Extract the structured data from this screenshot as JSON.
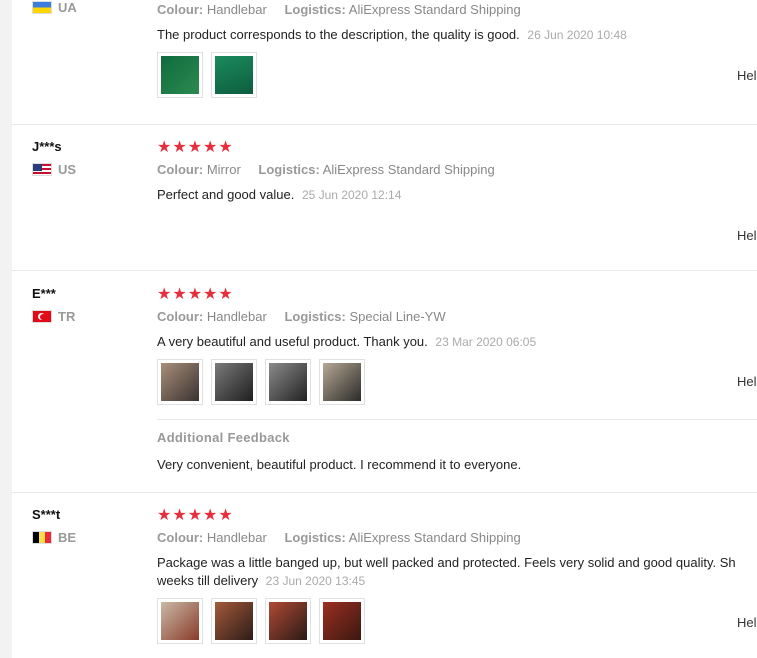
{
  "reviews": [
    {
      "name": "",
      "country": "UA",
      "colour_label": "Colour:",
      "colour": "Handlebar",
      "logistics_label": "Logistics:",
      "logistics": "AliExpress Standard Shipping",
      "text": "The product corresponds to the description, the quality is good.",
      "date": "26 Jun 2020 10:48",
      "helpful": "Hel",
      "thumbs": [
        "#1f6b3a",
        "#1f7a5a"
      ]
    },
    {
      "name": "J***s",
      "country": "US",
      "stars": "★★★★★",
      "colour_label": "Colour:",
      "colour": "Mirror",
      "logistics_label": "Logistics:",
      "logistics": "AliExpress Standard Shipping",
      "text": "Perfect and good value.",
      "date": "25 Jun 2020 12:14",
      "helpful": "Hel"
    },
    {
      "name": "E***",
      "country": "TR",
      "stars": "★★★★★",
      "colour_label": "Colour:",
      "colour": "Handlebar",
      "logistics_label": "Logistics:",
      "logistics": "Special Line-YW",
      "text": "A very beautiful and useful product. Thank you.",
      "date": "23 Mar 2020 06:05",
      "helpful": "Hel",
      "additional_title": "Additional Feedback",
      "additional_text": "Very convenient, beautiful product. I recommend it to everyone."
    },
    {
      "name": "S***t",
      "country": "BE",
      "stars": "★★★★★",
      "colour_label": "Colour:",
      "colour": "Handlebar",
      "logistics_label": "Logistics:",
      "logistics": "AliExpress Standard Shipping",
      "text_line1": "Package was a little banged up, but well packed and protected. Feels very solid and good quality. Sh",
      "text_line2": "weeks till delivery",
      "date": "23 Jun 2020 13:45",
      "helpful": "Hel"
    }
  ]
}
